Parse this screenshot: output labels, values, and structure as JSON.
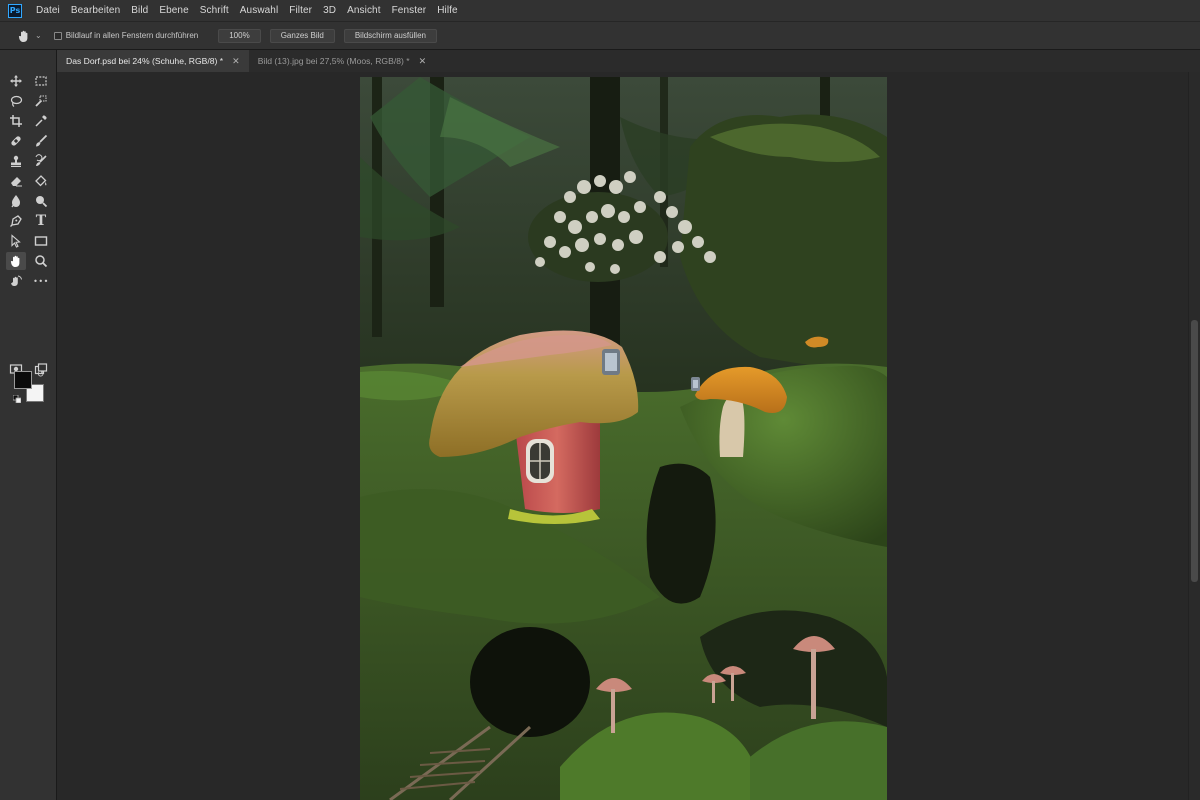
{
  "app": {
    "logo_text": "Ps",
    "menu": [
      "Datei",
      "Bearbeiten",
      "Bild",
      "Ebene",
      "Schrift",
      "Auswahl",
      "Filter",
      "3D",
      "Ansicht",
      "Fenster",
      "Hilfe"
    ]
  },
  "options": {
    "scroll_all_label": "Bildlauf in allen Fenstern durchführen",
    "zoom_btn": "100%",
    "fit_btn": "Ganzes Bild",
    "fill_btn": "Bildschirm ausfüllen"
  },
  "tabs": [
    {
      "label": "Das Dorf.psd bei 24% (Schuhe, RGB/8) *",
      "active": true
    },
    {
      "label": "Bild (13).jpg bei 27,5% (Moos, RGB/8) *",
      "active": false
    }
  ],
  "tools": {
    "foreground_color": "#0b0b0b",
    "background_color": "#f4f4f4",
    "active_tool": "hand-tool",
    "text_tool_glyph": "T",
    "more_glyph": "•••"
  },
  "colors": {
    "accent": "#31a8ff",
    "panel": "#323232",
    "canvas_bg": "#282828"
  }
}
